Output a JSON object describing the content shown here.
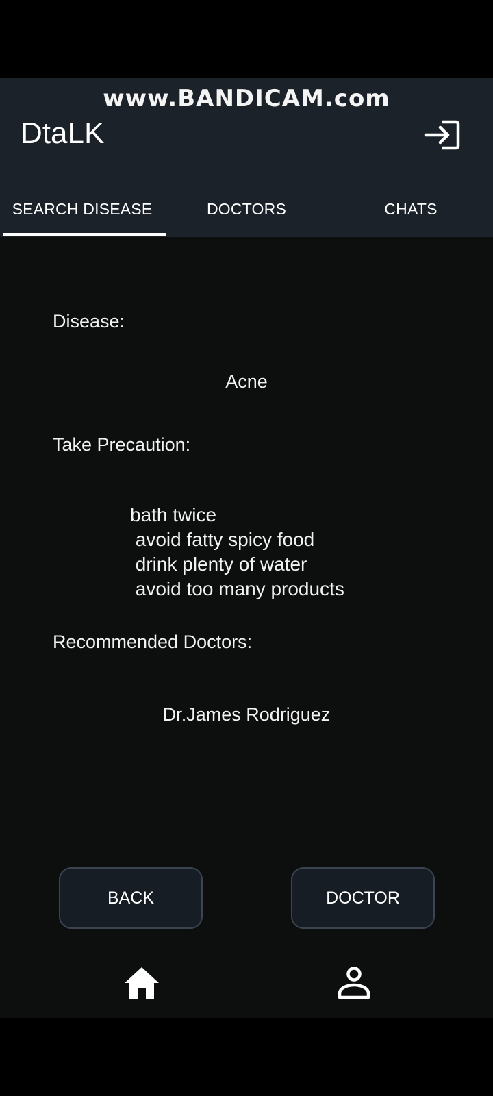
{
  "watermark": "www.BANDICAM.com",
  "app_title": "DtaLK",
  "tabs": [
    {
      "label": "SEARCH DISEASE",
      "selected": true
    },
    {
      "label": "DOCTORS",
      "selected": false
    },
    {
      "label": "CHATS",
      "selected": false
    }
  ],
  "disease": {
    "label": "Disease:",
    "value": "Acne"
  },
  "precaution": {
    "label": "Take Precaution:",
    "items": [
      "bath twice",
      " avoid fatty spicy food",
      " drink plenty of water",
      " avoid too many products"
    ]
  },
  "doctors": {
    "label": "Recommended Doctors:",
    "value": "Dr.James Rodriguez"
  },
  "buttons": {
    "back": "BACK",
    "doctor": "DOCTOR"
  },
  "icons": {
    "logout": "login-arrow-icon",
    "home": "home-icon",
    "profile": "person-icon"
  },
  "colors": {
    "appbar": "#1c2229",
    "background": "#0d0f0e",
    "text": "#f2f2f2",
    "indicator": "#ffffff"
  }
}
